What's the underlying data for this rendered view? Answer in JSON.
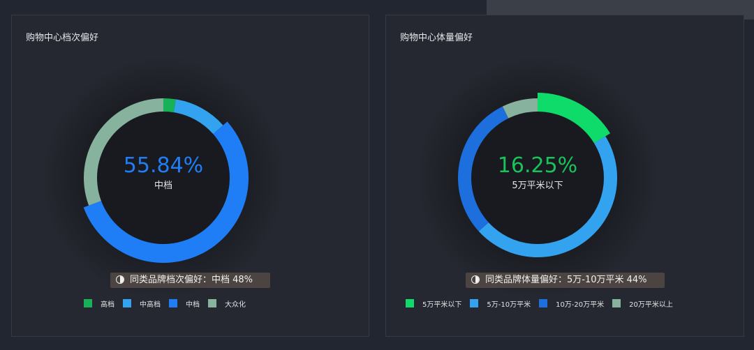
{
  "panels": [
    {
      "title": "购物中心档次偏好",
      "center_value": "55.84%",
      "center_label": "中档",
      "center_color": "#1f7ef5",
      "preference_text": "同类品牌档次偏好：中档 48%"
    },
    {
      "title": "购物中心体量偏好",
      "center_value": "16.25%",
      "center_label": "5万平米以下",
      "center_color": "#19c25a",
      "preference_text": "同类品牌体量偏好：5万-10万平米 44%"
    }
  ],
  "chart_data": [
    {
      "type": "pie",
      "title": "购物中心档次偏好",
      "donut": true,
      "highlighted": "中档",
      "slices": [
        {
          "name": "高档",
          "value": 2.5,
          "color": "#17b257"
        },
        {
          "name": "中高档",
          "value": 11.0,
          "color": "#33a3f0"
        },
        {
          "name": "中档",
          "value": 55.84,
          "color": "#1f7ef5"
        },
        {
          "name": "大众化",
          "value": 30.66,
          "color": "#87b29d"
        }
      ]
    },
    {
      "type": "pie",
      "title": "购物中心体量偏好",
      "donut": true,
      "highlighted": "5万平米以下",
      "slices": [
        {
          "name": "5万平米以下",
          "value": 16.25,
          "color": "#0fdb6b"
        },
        {
          "name": "5万-10万平米",
          "value": 47.0,
          "color": "#33a3f0"
        },
        {
          "name": "10万-20万平米",
          "value": 29.5,
          "color": "#1c6fdd"
        },
        {
          "name": "20万平米以上",
          "value": 7.25,
          "color": "#87b29d"
        }
      ]
    }
  ]
}
